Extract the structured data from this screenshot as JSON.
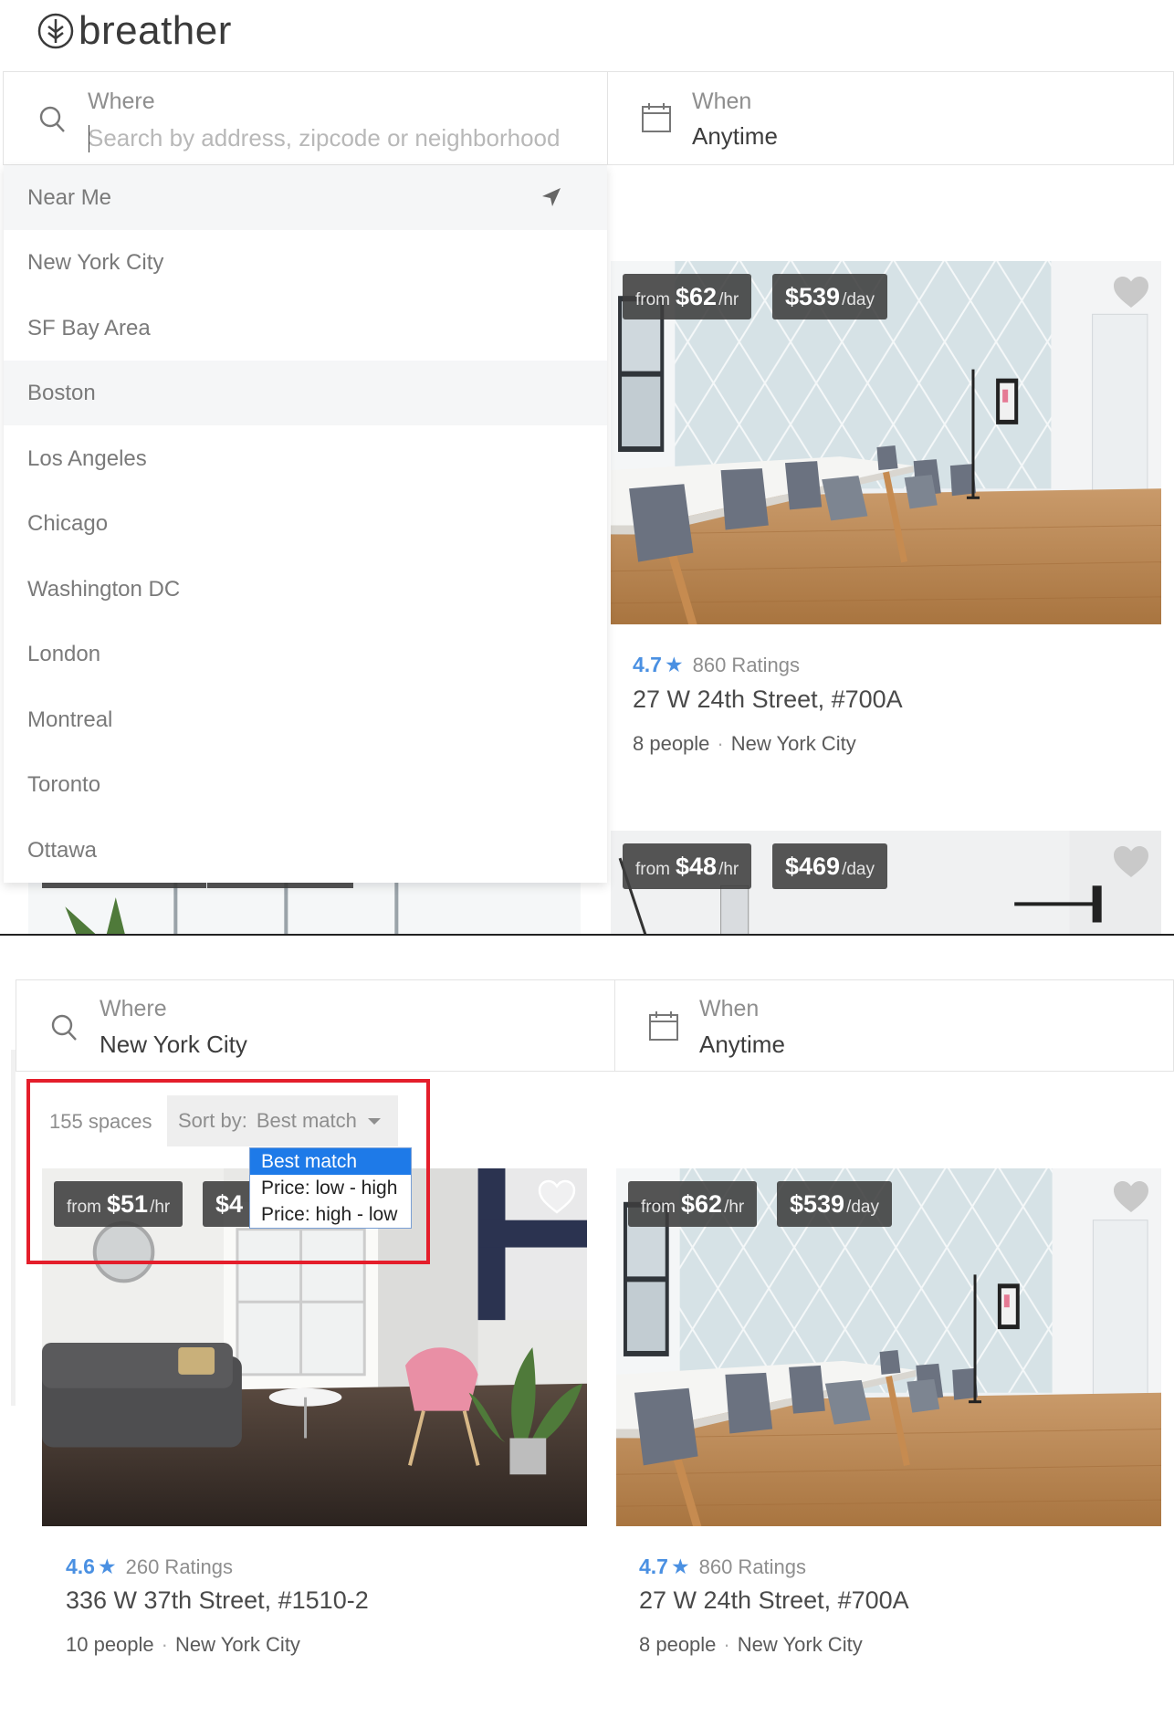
{
  "brand": {
    "name": "breather"
  },
  "top": {
    "where": {
      "label": "Where",
      "placeholder": "Search by address, zipcode or neighborhood",
      "value": ""
    },
    "when": {
      "label": "When",
      "value": "Anytime"
    },
    "dropdown": {
      "near_me": "Near Me",
      "cities": [
        "New York City",
        "SF Bay Area",
        "Boston",
        "Los Angeles",
        "Chicago",
        "Washington DC",
        "London",
        "Montreal",
        "Toronto",
        "Ottawa"
      ],
      "highlighted": "Boston"
    }
  },
  "bottom": {
    "where": {
      "label": "Where",
      "value": "New York City"
    },
    "when": {
      "label": "When",
      "value": "Anytime"
    },
    "results_count": "155 spaces",
    "sort": {
      "label": "Sort by:",
      "selected": "Best match",
      "options": [
        "Best match",
        "Price: low - high",
        "Price: high - low"
      ]
    }
  },
  "listings": [
    {
      "from_label": "from",
      "hourly": "$62",
      "hourly_unit": "/hr",
      "daily": "$539",
      "daily_unit": "/day",
      "rating": "4.7",
      "star": "★",
      "ratings_count": "860 Ratings",
      "address": "27 W 24th Street, #700A",
      "capacity": "8 people",
      "city": "New York City"
    },
    {
      "from_label": "from",
      "hourly": "$48",
      "hourly_unit": "/hr",
      "daily": "$469",
      "daily_unit": "/day"
    },
    {
      "from_label": "from",
      "hourly": "$51",
      "hourly_unit": "/hr",
      "daily_partial": "$4",
      "rating": "4.6",
      "star": "★",
      "ratings_count": "260 Ratings",
      "address": "336 W 37th Street, #1510-2",
      "capacity": "10 people",
      "city": "New York City"
    },
    {
      "from_label": "from",
      "hourly": "$62",
      "hourly_unit": "/hr",
      "daily": "$539",
      "daily_unit": "/day",
      "rating": "4.7",
      "star": "★",
      "ratings_count": "860 Ratings",
      "address": "27 W 24th Street, #700A",
      "capacity": "8 people",
      "city": "New York City"
    }
  ],
  "colors": {
    "accent": "#4a90e2",
    "highlight_box": "#e41e2b",
    "select_blue": "#1e7ae8"
  }
}
